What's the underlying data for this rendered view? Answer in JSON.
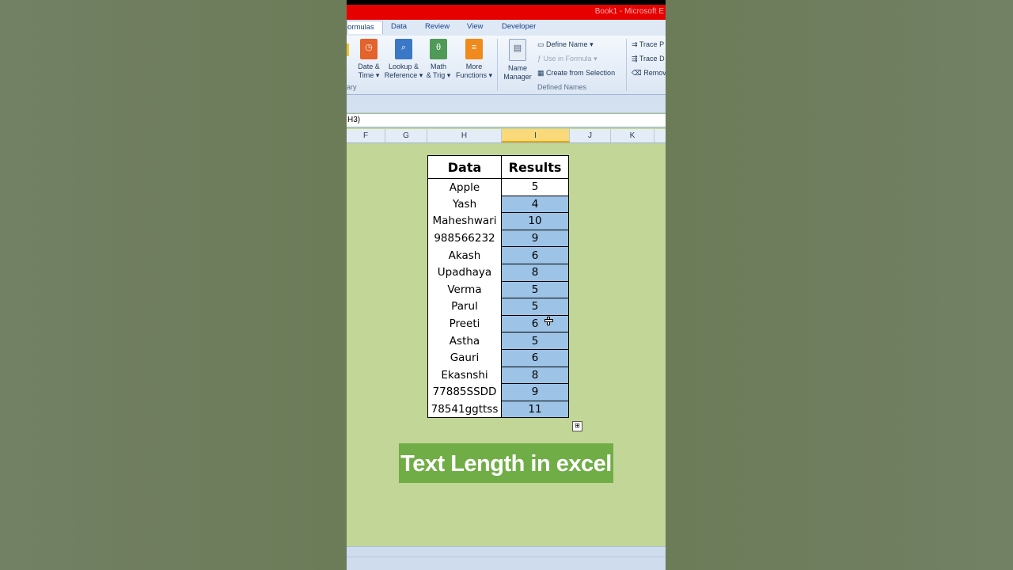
{
  "window": {
    "title": "Book1 - Microsoft E"
  },
  "tabs": [
    "ormulas",
    "Data",
    "Review",
    "View",
    "Developer"
  ],
  "ribbon": {
    "buttons": [
      {
        "line1": "Date &",
        "line2": "Time",
        "icon": "clock-book-icon",
        "color": "#e4622b"
      },
      {
        "line1": "Lookup &",
        "line2": "Reference",
        "icon": "magnifier-book-icon",
        "color": "#3a77c4"
      },
      {
        "line1": "Math",
        "line2": "& Trig",
        "icon": "theta-book-icon",
        "color": "#4f9a56"
      },
      {
        "line1": "More",
        "line2": "Functions",
        "icon": "more-book-icon",
        "color": "#f08a1c"
      }
    ],
    "library_group": "ary",
    "name_manager": {
      "line1": "Name",
      "line2": "Manager"
    },
    "define_name": "Define Name",
    "use_in_formula": "Use in Formula",
    "create_from_selection": "Create from Selection",
    "defined_names_group": "Defined Names",
    "trace_precedents": "Trace P",
    "trace_dependents": "Trace D",
    "remove_arrows": "Remov"
  },
  "formula_bar": {
    "text": "H3)"
  },
  "columns": [
    "F",
    "G",
    "H",
    "I",
    "J",
    "K"
  ],
  "selected_column": "I",
  "table": {
    "header_data": "Data",
    "header_results": "Results",
    "rows": [
      {
        "data": "Apple",
        "result": "5"
      },
      {
        "data": "Yash",
        "result": "4"
      },
      {
        "data": "Maheshwari",
        "result": "10"
      },
      {
        "data": "988566232",
        "result": "9"
      },
      {
        "data": "Akash",
        "result": "6"
      },
      {
        "data": "Upadhaya",
        "result": "8"
      },
      {
        "data": "Verma",
        "result": "5"
      },
      {
        "data": "Parul",
        "result": "5"
      },
      {
        "data": "Preeti",
        "result": "6"
      },
      {
        "data": "Astha",
        "result": "5"
      },
      {
        "data": "Gauri",
        "result": "6"
      },
      {
        "data": "Ekasnshi",
        "result": "8"
      },
      {
        "data": "77885SSDD",
        "result": "9"
      },
      {
        "data": "78541ggttss",
        "result": "11"
      }
    ]
  },
  "banner": {
    "text": "Text Length in excel"
  },
  "colors": {
    "sheet_bg": "#c2d697",
    "selection": "#9dc3e6",
    "banner": "#70ad47",
    "title_bar": "#e60000"
  }
}
